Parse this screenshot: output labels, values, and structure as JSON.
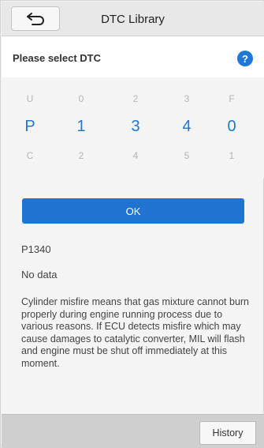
{
  "header": {
    "title": "DTC Library",
    "back_icon": "back-arrow-icon"
  },
  "section": {
    "title": "Please select DTC",
    "help_label": "?"
  },
  "picker": {
    "row_above": [
      "U",
      "0",
      "2",
      "3",
      "F"
    ],
    "row_selected": [
      "P",
      "1",
      "3",
      "4",
      "0"
    ],
    "row_below": [
      "C",
      "2",
      "4",
      "5",
      "1"
    ]
  },
  "ok_label": "OK",
  "result": {
    "code": "P1340",
    "status": "No data",
    "description": "Cylinder misfire means that gas mixture cannot burn properly during engine running process due to various reasons. If ECU detects misfire which may cause damages to catalytic converter, MIL will flash and engine must be shut off immediately at this moment."
  },
  "footer": {
    "history_label": "History"
  },
  "colors": {
    "accent": "#1f74d2",
    "header_bg": "#e8e8e8",
    "footer_bg": "#cfcfcf"
  }
}
